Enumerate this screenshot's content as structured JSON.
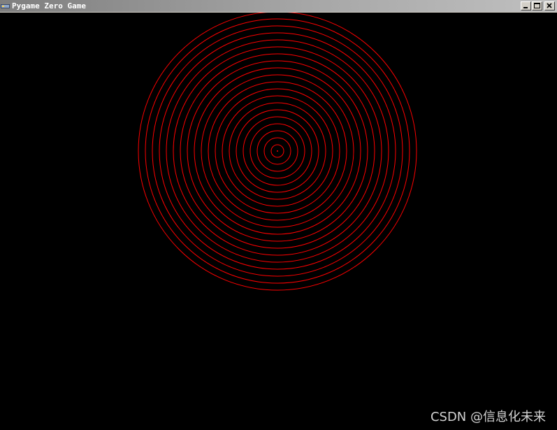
{
  "window": {
    "title": "Pygame Zero Game",
    "app_icon": "pygame-icon",
    "controls": {
      "minimize_icon": "minimize-icon",
      "maximize_icon": "maximize-icon",
      "close_icon": "close-icon"
    }
  },
  "scene": {
    "background_color": "#000000",
    "ring_color": "#ff0000",
    "ring_count": 20,
    "center_dot": true
  },
  "watermark": {
    "text": "CSDN @信息化未来"
  }
}
